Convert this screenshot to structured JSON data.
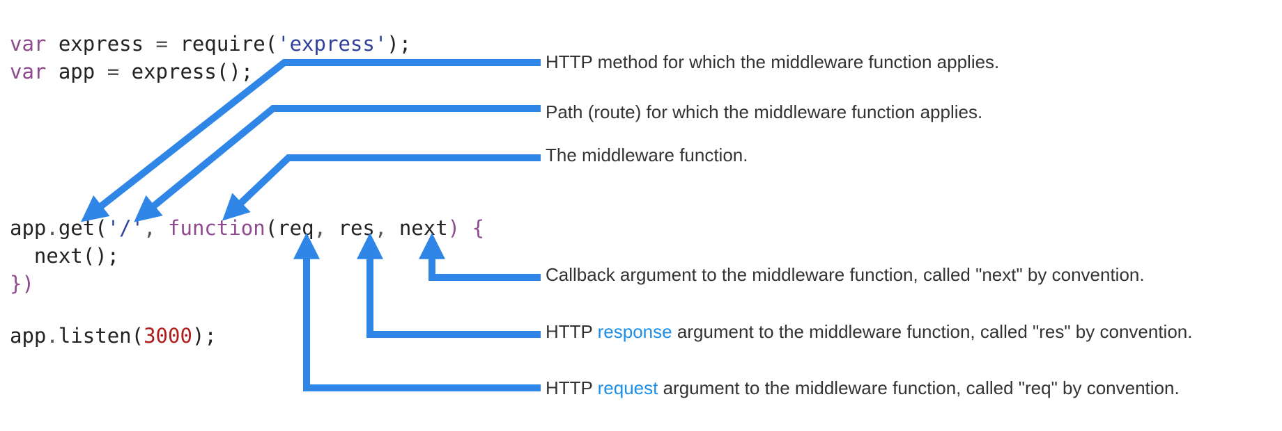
{
  "code": {
    "line1": {
      "kw": "var",
      "text": " express ",
      "eq": "=",
      "fn": " require(",
      "str": "'express'",
      "end": ");"
    },
    "line2": {
      "kw": "var",
      "text": " app ",
      "eq": "=",
      "fn": " express",
      "end": "();"
    },
    "line3": {
      "obj": "app",
      "dot": ".",
      "method": "get",
      "open": "(",
      "path": "'/'",
      "comma1": ", ",
      "func": "function",
      "params_open": "(",
      "req": "req",
      "comma2": ", ",
      "res": "res",
      "comma3": ", ",
      "next": "next",
      "close": ") {"
    },
    "line4": {
      "indent": "  ",
      "call": "next",
      "end": "();"
    },
    "line5": {
      "close": "})"
    },
    "line6": {
      "obj": "app",
      "dot": ".",
      "method": "listen",
      "open": "(",
      "port": "3000",
      "end": ");"
    }
  },
  "annotations": {
    "method": "HTTP method for which the middleware function applies.",
    "path": "Path (route) for which the middleware function applies.",
    "function": "The middleware function.",
    "next": "Callback argument to the middleware function, called \"next\" by convention.",
    "response": {
      "prefix": "HTTP ",
      "link": "response",
      "suffix": " argument to the middleware function, called \"res\" by convention."
    },
    "request": {
      "prefix": "HTTP ",
      "link": "request",
      "suffix": " argument to the middleware function, called \"req\" by convention."
    }
  },
  "colors": {
    "arrow": "#2f86e6",
    "link": "#1c8ee8",
    "keyword": "#8e4a8e",
    "string": "#2f3f9a",
    "number": "#b01e1e"
  }
}
